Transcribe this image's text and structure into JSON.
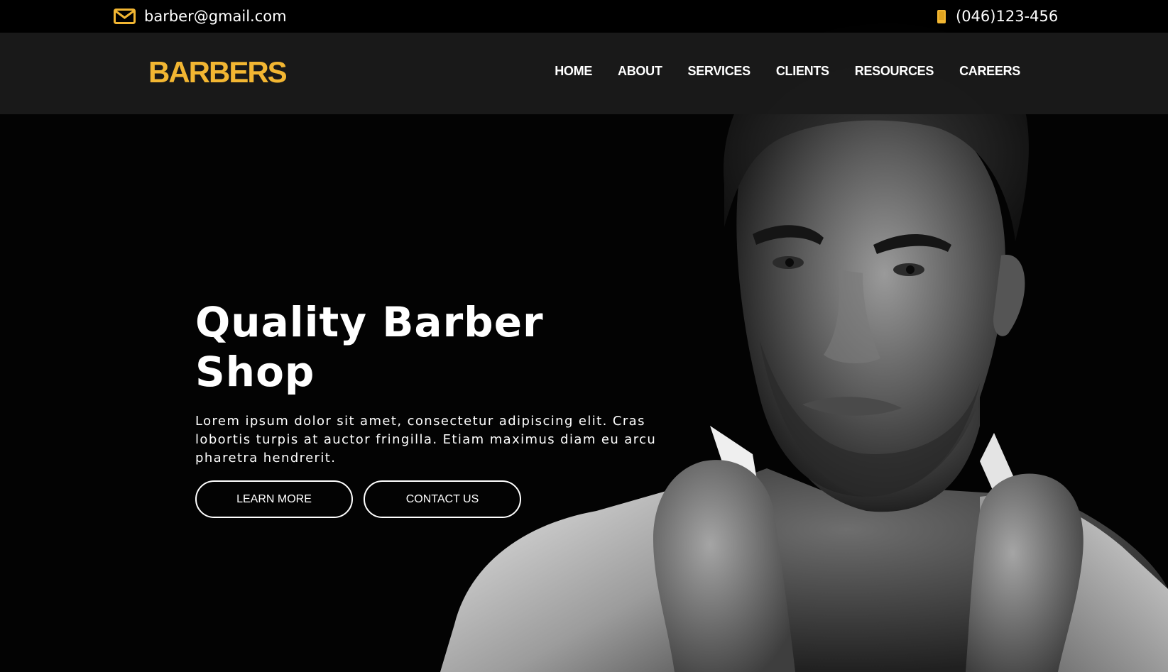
{
  "topbar": {
    "email": "barber@gmail.com",
    "email_icon": "mail-icon",
    "phone": "(046)123-456",
    "phone_icon": "phone-icon"
  },
  "header": {
    "logo": "BARBERS",
    "nav": [
      "HOME",
      "ABOUT",
      "SERVICES",
      "CLIENTS",
      "RESOURCES",
      "CAREERS"
    ]
  },
  "hero": {
    "title": "Quality Barber Shop",
    "description": "Lorem ipsum dolor sit amet, consectetur adipiscing elit. Cras lobortis turpis at auctor fringilla. Etiam maximus diam eu arcu pharetra hendrerit.",
    "buttons": {
      "learn_more": "LEARN MORE",
      "contact_us": "CONTACT US"
    },
    "image": "black-and-white portrait of a man holding his shirt collar"
  },
  "colors": {
    "accent": "#f2b632",
    "background": "#030303",
    "navbar": "#1a1a1a",
    "text": "#ffffff"
  }
}
